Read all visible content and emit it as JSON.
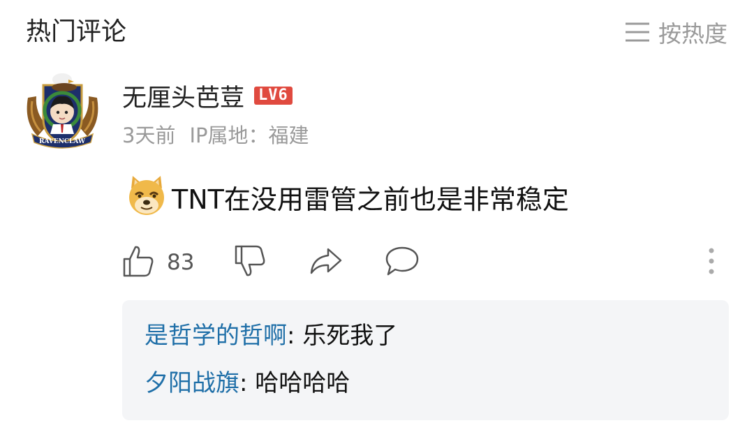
{
  "header": {
    "title": "热门评论",
    "sort_label": "按热度",
    "sort_icon": "menu-lines-icon"
  },
  "comment": {
    "avatar_text": "RAVENCLAW",
    "username": "无厘头芭荳",
    "level": "LV6",
    "time": "3天前",
    "ip_location": "IP属地：福建",
    "emoji": "doge-emoji",
    "text": "TNT在没用雷管之前也是非常稳定",
    "likes": "83"
  },
  "colors": {
    "reply_name": "#1f6fa8",
    "level_badge": "#e04a3f",
    "secondary_text": "#9a9a9a",
    "reply_bg": "#f4f5f7"
  },
  "replies": [
    {
      "name": "是哲学的哲啊",
      "text": ": 乐死我了"
    },
    {
      "name": "夕阳战旗",
      "text": ": 哈哈哈哈"
    }
  ]
}
